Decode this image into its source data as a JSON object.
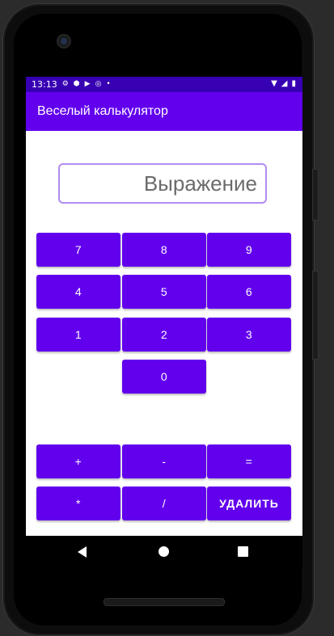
{
  "status_bar": {
    "time": "13:13",
    "icons_left": [
      "gear-icon",
      "shield-icon",
      "play-icon",
      "at-icon",
      "dot-icon"
    ],
    "icons_right": [
      "wifi-icon",
      "signal-icon",
      "battery-icon"
    ]
  },
  "app_bar": {
    "title": "Веселый калькулятор"
  },
  "expression_field": {
    "placeholder": "Выражение",
    "value": ""
  },
  "keypad": {
    "digits": [
      [
        "7",
        "8",
        "9"
      ],
      [
        "4",
        "5",
        "6"
      ],
      [
        "1",
        "2",
        "3"
      ]
    ],
    "zero": "0"
  },
  "operators": {
    "plus": "+",
    "minus": "-",
    "equals": "=",
    "multiply": "*",
    "divide": "/",
    "delete": "УДАЛИТЬ"
  },
  "navigation": [
    "back-icon",
    "home-icon",
    "recents-icon"
  ],
  "colors": {
    "primary": "#6200ee",
    "primary_dark": "#3700b3",
    "input_border": "#b18cf2"
  }
}
